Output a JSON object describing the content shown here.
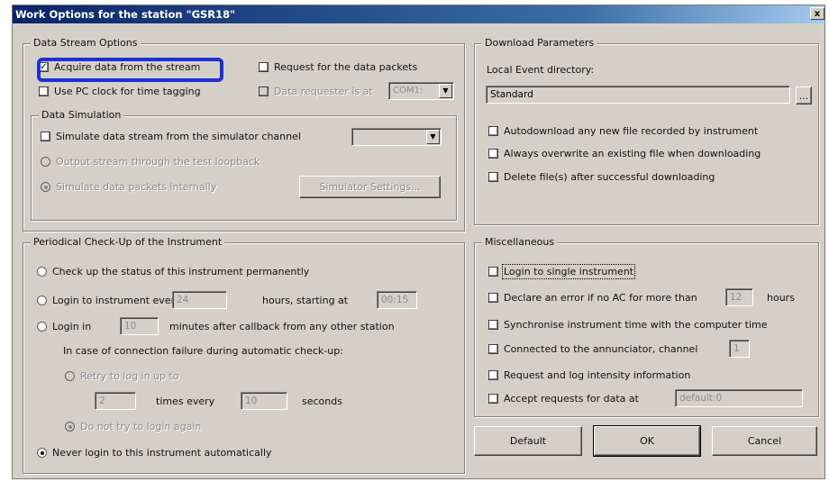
{
  "window": {
    "title": "Work Options for the station \"GSR18\"",
    "close_glyph": "x"
  },
  "data_stream": {
    "legend": "Data Stream Options",
    "acquire_label": "Acquire data from the stream",
    "acquire_checked": true,
    "use_pc_clock_label": "Use PC clock for time tagging",
    "request_packets_label": "Request for the data packets",
    "data_requester_label": "Data requester is at",
    "data_requester_value": "COM1:",
    "simulation": {
      "legend": "Data Simulation",
      "simulate_label": "Simulate data stream from the simulator channel",
      "output_loopback_label": "Output stream through the test loopback",
      "simulate_internally_label": "Simulate data packets internally",
      "simulator_settings_label": "Simulator Settings..."
    }
  },
  "download": {
    "legend": "Download Parameters",
    "local_dir_label": "Local Event directory:",
    "local_dir_value": "Standard",
    "browse_label": "...",
    "autodownload_label": "Autodownload any new file recorded by instrument",
    "overwrite_label": "Always overwrite an existing file when downloading",
    "delete_label": "Delete file(s) after successful downloading"
  },
  "checkup": {
    "legend": "Periodical Check-Up of the Instrument",
    "permanent_label": "Check up the status of this instrument permanently",
    "login_every_label": "Login to instrument every",
    "login_every_value": "24",
    "hours_starting_label": "hours, starting at",
    "starting_value": "00:15",
    "login_in_label": "Login in",
    "login_in_value": "10",
    "minutes_after_label": "minutes after callback from any other station",
    "failure_label": "In case of connection failure during automatic check-up:",
    "retry_label": "Retry to log in up to",
    "retry_times_value": "2",
    "times_every_label": "times every",
    "times_every_value": "10",
    "seconds_label": "seconds",
    "do_not_retry_label": "Do not try to login again",
    "never_label": "Never login to this instrument automatically"
  },
  "misc": {
    "legend": "Miscellaneous",
    "login_single_label": "Login to single instrument",
    "declare_error_label": "Declare an error if no AC for more than",
    "declare_error_value": "12",
    "hours_label": "hours",
    "sync_label": "Synchronise instrument time with the computer time",
    "connected_label": "Connected to the annunciator, channel",
    "connected_value": "1",
    "request_log_label": "Request and log intensity information",
    "accept_label": "Accept requests for data at",
    "accept_value": "default:0"
  },
  "buttons": {
    "default": "Default",
    "ok": "OK",
    "cancel": "Cancel"
  },
  "colors": {
    "highlight": "#1d2fd6",
    "title_bar": "#0a246a",
    "dialog_bg": "#d4d0c8"
  }
}
